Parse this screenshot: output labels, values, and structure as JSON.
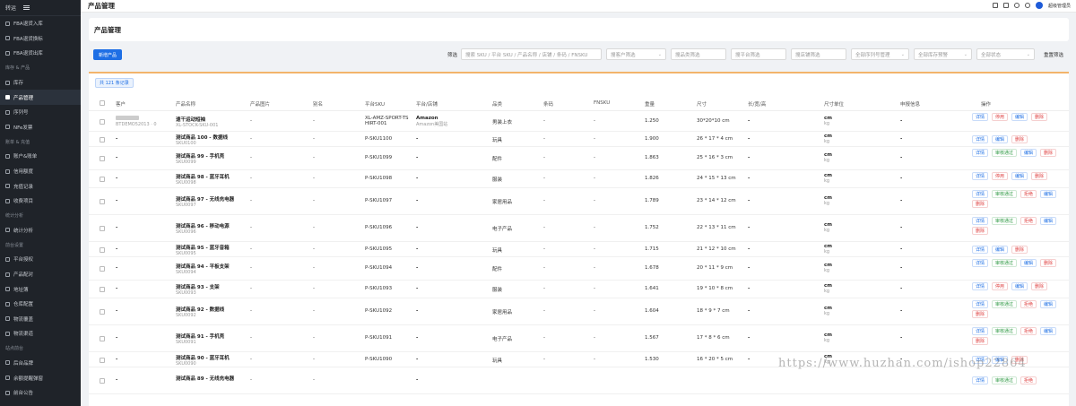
{
  "sidebar": {
    "top_label": "转运",
    "items": [
      {
        "label": "FBA退货入库",
        "section": null
      },
      {
        "label": "FBA退货换标",
        "section": null
      },
      {
        "label": "FBA退货出库",
        "section": null
      },
      {
        "label": "库存 & 产品",
        "section": true
      },
      {
        "label": "库存",
        "section": null
      },
      {
        "label": "产品管理",
        "section": null,
        "active": true
      },
      {
        "label": "序列号",
        "section": null
      },
      {
        "label": "NFe发票",
        "section": null
      },
      {
        "label": "账单 & 充值",
        "section": true
      },
      {
        "label": "账户&账单",
        "section": null
      },
      {
        "label": "信用额度",
        "section": null
      },
      {
        "label": "充值记录",
        "section": null
      },
      {
        "label": "收费项目",
        "section": null
      },
      {
        "label": "统计分析",
        "section": true
      },
      {
        "label": "统计分析",
        "section": null
      },
      {
        "label": "前台设置",
        "section": true
      },
      {
        "label": "平台授权",
        "section": null
      },
      {
        "label": "产品配对",
        "section": null
      },
      {
        "label": "地址簿",
        "section": null
      },
      {
        "label": "仓库配置",
        "section": null
      },
      {
        "label": "物流覆盖",
        "section": null
      },
      {
        "label": "物流渠道",
        "section": null
      },
      {
        "label": "站点前台",
        "section": true
      },
      {
        "label": "后台品牌",
        "section": null
      },
      {
        "label": "余额提醒弹窗",
        "section": null
      },
      {
        "label": "前台公告",
        "section": null
      }
    ]
  },
  "topbar": {
    "title": "产品管理",
    "user": "超级管理员"
  },
  "page_header": {
    "title": "产品管理"
  },
  "filters": {
    "new_button": "新增产品",
    "label": "筛选",
    "search_placeholder": "搜索 SKU / 平台 SKU / 产品名称 / 店铺 / 条码 / FNSKU",
    "customer_placeholder": "搜客户筛选",
    "category_placeholder": "搜品类筛选",
    "platform_placeholder": "搜平台筛选",
    "store_placeholder": "搜店铺筛选",
    "serial_select": "全部序列号管理",
    "stock_select": "全部库存预警",
    "status_select": "全部状态",
    "reset": "重置筛选"
  },
  "table": {
    "count_label": "共 121 条记录",
    "headers": [
      "客户",
      "产品名称",
      "产品图片",
      "别名",
      "平台SKU",
      "平台/店铺",
      "品类",
      "条码",
      "FNSKU",
      "重量",
      "尺寸",
      "长/宽/高",
      "尺寸单位",
      "申报信息",
      "操作"
    ],
    "rows": [
      {
        "customer": "",
        "customer_sub": "BTDEMO52013 · 0",
        "name": "速干运动短袖",
        "sku": "XL-STOCK-SKU-001",
        "image": "-",
        "alias": "-",
        "psku": "XL-AMZ-SPORT-TSHIRT-001",
        "platform": "Amazon",
        "store": "Amazon美国站",
        "category": "男装上衣",
        "barcode": "-",
        "fnsku": "-",
        "weight": "1.250",
        "size": "30*20*10 cm",
        "lwh": "-",
        "unit": "cm",
        "unit2": "kg",
        "declare": "-",
        "ops": [
          [
            "详情",
            "blue"
          ],
          [
            "停用",
            "red"
          ],
          [
            "编辑",
            "blue"
          ],
          [
            "删除",
            "red"
          ]
        ]
      },
      {
        "customer": "-",
        "name": "测试商品 100 - 数据线",
        "sku": "SKU0100",
        "image": "-",
        "alias": "-",
        "psku": "P-SKU1100",
        "platform": "-",
        "category": "玩具",
        "barcode": "-",
        "fnsku": "-",
        "weight": "1.900",
        "size": "26 * 17 * 4 cm",
        "lwh": "-",
        "unit": "cm",
        "unit2": "kg",
        "declare": "-",
        "ops": [
          [
            "详情",
            "blue"
          ],
          [
            "编辑",
            "blue"
          ],
          [
            "删除",
            "red"
          ]
        ]
      },
      {
        "customer": "-",
        "name": "测试商品 99 - 手机壳",
        "sku": "SKU0099",
        "image": "-",
        "alias": "-",
        "psku": "P-SKU1099",
        "platform": "-",
        "category": "配件",
        "barcode": "-",
        "fnsku": "-",
        "weight": "1.863",
        "size": "25 * 16 * 3 cm",
        "lwh": "-",
        "unit": "cm",
        "unit2": "kg",
        "declare": "-",
        "ops": [
          [
            "详情",
            "blue"
          ],
          [
            "审核通过",
            "green"
          ],
          [
            "编辑",
            "blue"
          ],
          [
            "删除",
            "red"
          ]
        ]
      },
      {
        "customer": "-",
        "name": "测试商品 98 - 蓝牙耳机",
        "sku": "SKU0098",
        "image": "-",
        "alias": "-",
        "psku": "P-SKU1098",
        "platform": "-",
        "category": "服装",
        "barcode": "-",
        "fnsku": "-",
        "weight": "1.826",
        "size": "24 * 15 * 13 cm",
        "lwh": "-",
        "unit": "cm",
        "unit2": "kg",
        "declare": "-",
        "ops": [
          [
            "详情",
            "blue"
          ],
          [
            "停用",
            "red"
          ],
          [
            "编辑",
            "blue"
          ],
          [
            "删除",
            "red"
          ]
        ]
      },
      {
        "customer": "-",
        "name": "测试商品 97 - 无线充电器",
        "sku": "SKU0097",
        "image": "-",
        "alias": "-",
        "psku": "P-SKU1097",
        "platform": "-",
        "category": "家居用品",
        "barcode": "-",
        "fnsku": "-",
        "weight": "1.789",
        "size": "23 * 14 * 12 cm",
        "lwh": "-",
        "unit": "cm",
        "unit2": "kg",
        "declare": "-",
        "ops": [
          [
            "详情",
            "blue"
          ],
          [
            "审核通过",
            "green"
          ],
          [
            "拒绝",
            "red"
          ],
          [
            "编辑",
            "blue"
          ],
          [
            "删除",
            "red"
          ]
        ]
      },
      {
        "customer": "-",
        "name": "测试商品 96 - 移动电源",
        "sku": "SKU0096",
        "image": "-",
        "alias": "-",
        "psku": "P-SKU1096",
        "platform": "-",
        "category": "电子产品",
        "barcode": "-",
        "fnsku": "-",
        "weight": "1.752",
        "size": "22 * 13 * 11 cm",
        "lwh": "-",
        "unit": "cm",
        "unit2": "kg",
        "declare": "-",
        "ops": [
          [
            "详情",
            "blue"
          ],
          [
            "审核通过",
            "green"
          ],
          [
            "拒绝",
            "red"
          ],
          [
            "编辑",
            "blue"
          ],
          [
            "删除",
            "red"
          ]
        ]
      },
      {
        "customer": "-",
        "name": "测试商品 95 - 蓝牙音箱",
        "sku": "SKU0095",
        "image": "-",
        "alias": "-",
        "psku": "P-SKU1095",
        "platform": "-",
        "category": "玩具",
        "barcode": "-",
        "fnsku": "-",
        "weight": "1.715",
        "size": "21 * 12 * 10 cm",
        "lwh": "-",
        "unit": "cm",
        "unit2": "kg",
        "declare": "-",
        "ops": [
          [
            "详情",
            "blue"
          ],
          [
            "编辑",
            "blue"
          ],
          [
            "删除",
            "red"
          ]
        ]
      },
      {
        "customer": "-",
        "name": "测试商品 94 - 平板支架",
        "sku": "SKU0094",
        "image": "-",
        "alias": "-",
        "psku": "P-SKU1094",
        "platform": "-",
        "category": "配件",
        "barcode": "-",
        "fnsku": "-",
        "weight": "1.678",
        "size": "20 * 11 * 9 cm",
        "lwh": "-",
        "unit": "cm",
        "unit2": "kg",
        "declare": "-",
        "ops": [
          [
            "详情",
            "blue"
          ],
          [
            "审核通过",
            "green"
          ],
          [
            "编辑",
            "blue"
          ],
          [
            "删除",
            "red"
          ]
        ]
      },
      {
        "customer": "-",
        "name": "测试商品 93 - 支架",
        "sku": "SKU0093",
        "image": "-",
        "alias": "-",
        "psku": "P-SKU1093",
        "platform": "-",
        "category": "服装",
        "barcode": "-",
        "fnsku": "-",
        "weight": "1.641",
        "size": "19 * 10 * 8 cm",
        "lwh": "-",
        "unit": "cm",
        "unit2": "kg",
        "declare": "-",
        "ops": [
          [
            "详情",
            "blue"
          ],
          [
            "停用",
            "red"
          ],
          [
            "编辑",
            "blue"
          ],
          [
            "删除",
            "red"
          ]
        ]
      },
      {
        "customer": "-",
        "name": "测试商品 92 - 数据线",
        "sku": "SKU0092",
        "image": "-",
        "alias": "-",
        "psku": "P-SKU1092",
        "platform": "-",
        "category": "家居用品",
        "barcode": "-",
        "fnsku": "-",
        "weight": "1.604",
        "size": "18 * 9 * 7 cm",
        "lwh": "-",
        "unit": "cm",
        "unit2": "kg",
        "declare": "-",
        "ops": [
          [
            "详情",
            "blue"
          ],
          [
            "审核通过",
            "green"
          ],
          [
            "拒绝",
            "red"
          ],
          [
            "编辑",
            "blue"
          ],
          [
            "删除",
            "red"
          ]
        ]
      },
      {
        "customer": "-",
        "name": "测试商品 91 - 手机壳",
        "sku": "SKU0091",
        "image": "-",
        "alias": "-",
        "psku": "P-SKU1091",
        "platform": "-",
        "category": "电子产品",
        "barcode": "-",
        "fnsku": "-",
        "weight": "1.567",
        "size": "17 * 8 * 6 cm",
        "lwh": "-",
        "unit": "cm",
        "unit2": "kg",
        "declare": "-",
        "ops": [
          [
            "详情",
            "blue"
          ],
          [
            "审核通过",
            "green"
          ],
          [
            "拒绝",
            "red"
          ],
          [
            "编辑",
            "blue"
          ],
          [
            "删除",
            "red"
          ]
        ]
      },
      {
        "customer": "-",
        "name": "测试商品 90 - 蓝牙耳机",
        "sku": "SKU0090",
        "image": "-",
        "alias": "-",
        "psku": "P-SKU1090",
        "platform": "-",
        "category": "玩具",
        "barcode": "-",
        "fnsku": "-",
        "weight": "1.530",
        "size": "16 * 20 * 5 cm",
        "lwh": "-",
        "unit": "cm",
        "unit2": "kg",
        "declare": "-",
        "ops": [
          [
            "详情",
            "blue"
          ],
          [
            "编辑",
            "blue"
          ],
          [
            "删除",
            "red"
          ]
        ]
      },
      {
        "customer": "-",
        "name": "测试商品 89 - 无线充电器",
        "sku": "",
        "image": "-",
        "alias": "-",
        "psku": "",
        "platform": "-",
        "category": "",
        "barcode": "",
        "fnsku": "",
        "weight": "",
        "size": "",
        "lwh": "",
        "unit": "",
        "unit2": "",
        "declare": "",
        "ops": [
          [
            "详情",
            "blue"
          ],
          [
            "审核通过",
            "green"
          ],
          [
            "拒绝",
            "red"
          ]
        ]
      }
    ]
  },
  "watermark": "https://www.huzhan.com/ishop22864"
}
